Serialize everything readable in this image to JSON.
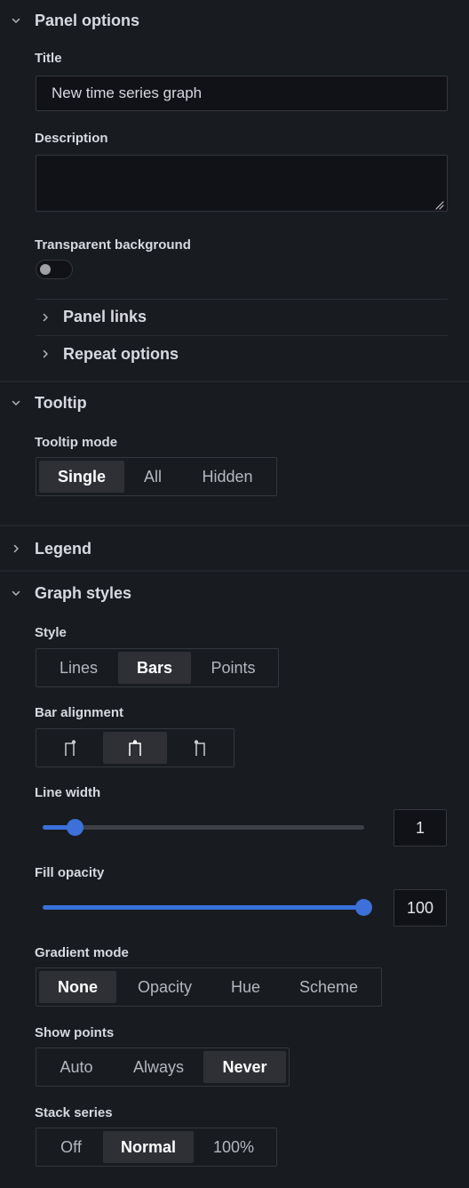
{
  "panel_options": {
    "title": "Panel options",
    "title_label": "Title",
    "title_value": "New time series graph",
    "description_label": "Description",
    "description_value": "",
    "transparent_label": "Transparent background",
    "transparent_on": false,
    "panel_links": "Panel links",
    "repeat_options": "Repeat options"
  },
  "tooltip": {
    "title": "Tooltip",
    "mode_label": "Tooltip mode",
    "modes": [
      "Single",
      "All",
      "Hidden"
    ],
    "selected": "Single"
  },
  "legend": {
    "title": "Legend"
  },
  "graph_styles": {
    "title": "Graph styles",
    "style_label": "Style",
    "styles": [
      "Lines",
      "Bars",
      "Points"
    ],
    "style_selected": "Bars",
    "bar_alignment_label": "Bar alignment",
    "bar_alignment_icons": [
      "bar-align-before-icon",
      "bar-align-center-icon",
      "bar-align-after-icon"
    ],
    "bar_alignment_selected": 1,
    "line_width_label": "Line width",
    "line_width_value": "1",
    "line_width_fraction": 0.1,
    "fill_opacity_label": "Fill opacity",
    "fill_opacity_value": "100",
    "fill_opacity_fraction": 1.0,
    "gradient_mode_label": "Gradient mode",
    "gradient_modes": [
      "None",
      "Opacity",
      "Hue",
      "Scheme"
    ],
    "gradient_selected": "None",
    "show_points_label": "Show points",
    "show_points_options": [
      "Auto",
      "Always",
      "Never"
    ],
    "show_points_selected": "Never",
    "stack_series_label": "Stack series",
    "stack_series_options": [
      "Off",
      "Normal",
      "100%"
    ],
    "stack_series_selected": "Normal"
  },
  "colors": {
    "background": "#181b1f",
    "accent": "#3d71d9",
    "input_bg": "#111217"
  }
}
